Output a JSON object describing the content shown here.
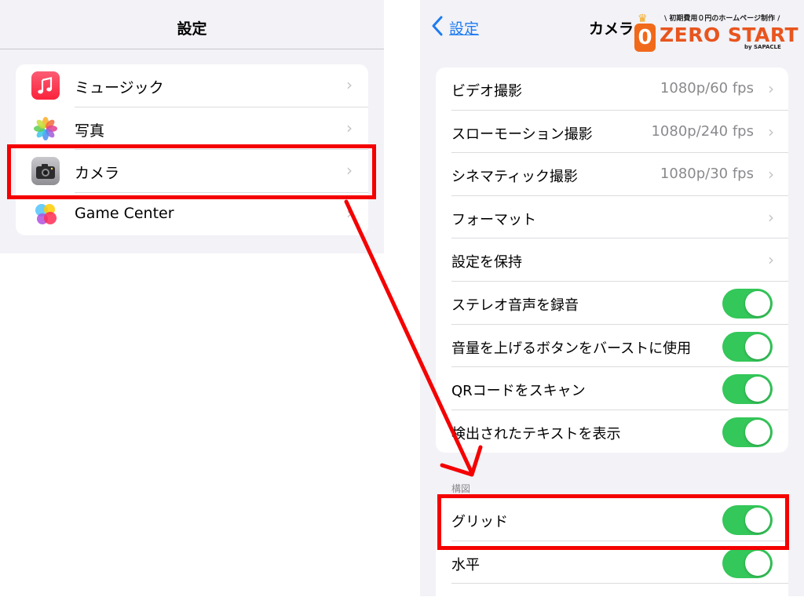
{
  "left": {
    "title": "設定",
    "items": [
      {
        "label": "ミュージック",
        "icon": "music-app-icon"
      },
      {
        "label": "写真",
        "icon": "photos-app-icon"
      },
      {
        "label": "カメラ",
        "icon": "camera-app-icon"
      },
      {
        "label": "Game Center",
        "icon": "game-center-app-icon"
      }
    ]
  },
  "right": {
    "back_label": "設定",
    "title": "カメラ",
    "rows": [
      {
        "label": "ビデオ撮影",
        "value": "1080p/60 fps"
      },
      {
        "label": "スローモーション撮影",
        "value": "1080p/240 fps"
      },
      {
        "label": "シネマティック撮影",
        "value": "1080p/30 fps"
      },
      {
        "label": "フォーマット",
        "value": ""
      },
      {
        "label": "設定を保持",
        "value": ""
      },
      {
        "label": "ステレオ音声を録音",
        "toggle": true
      },
      {
        "label": "音量を上げるボタンをバーストに使用",
        "toggle": true
      },
      {
        "label": "QRコードをスキャン",
        "toggle": true
      },
      {
        "label": "検出されたテキストを表示",
        "toggle": true
      }
    ],
    "section_header": "構図",
    "composition_rows": [
      {
        "label": "グリッド",
        "toggle": true
      },
      {
        "label": "水平",
        "toggle": true
      }
    ]
  },
  "logo": {
    "tagline": "\\ 初期費用０円のホームページ制作 /",
    "mark": "0",
    "text": "ZERO START",
    "by": "by SAPACLE"
  },
  "colors": {
    "toggle_on": "#34c759",
    "link_blue": "#1d7bf0",
    "annotation_red": "#f50000",
    "logo_orange": "#e8551e"
  }
}
